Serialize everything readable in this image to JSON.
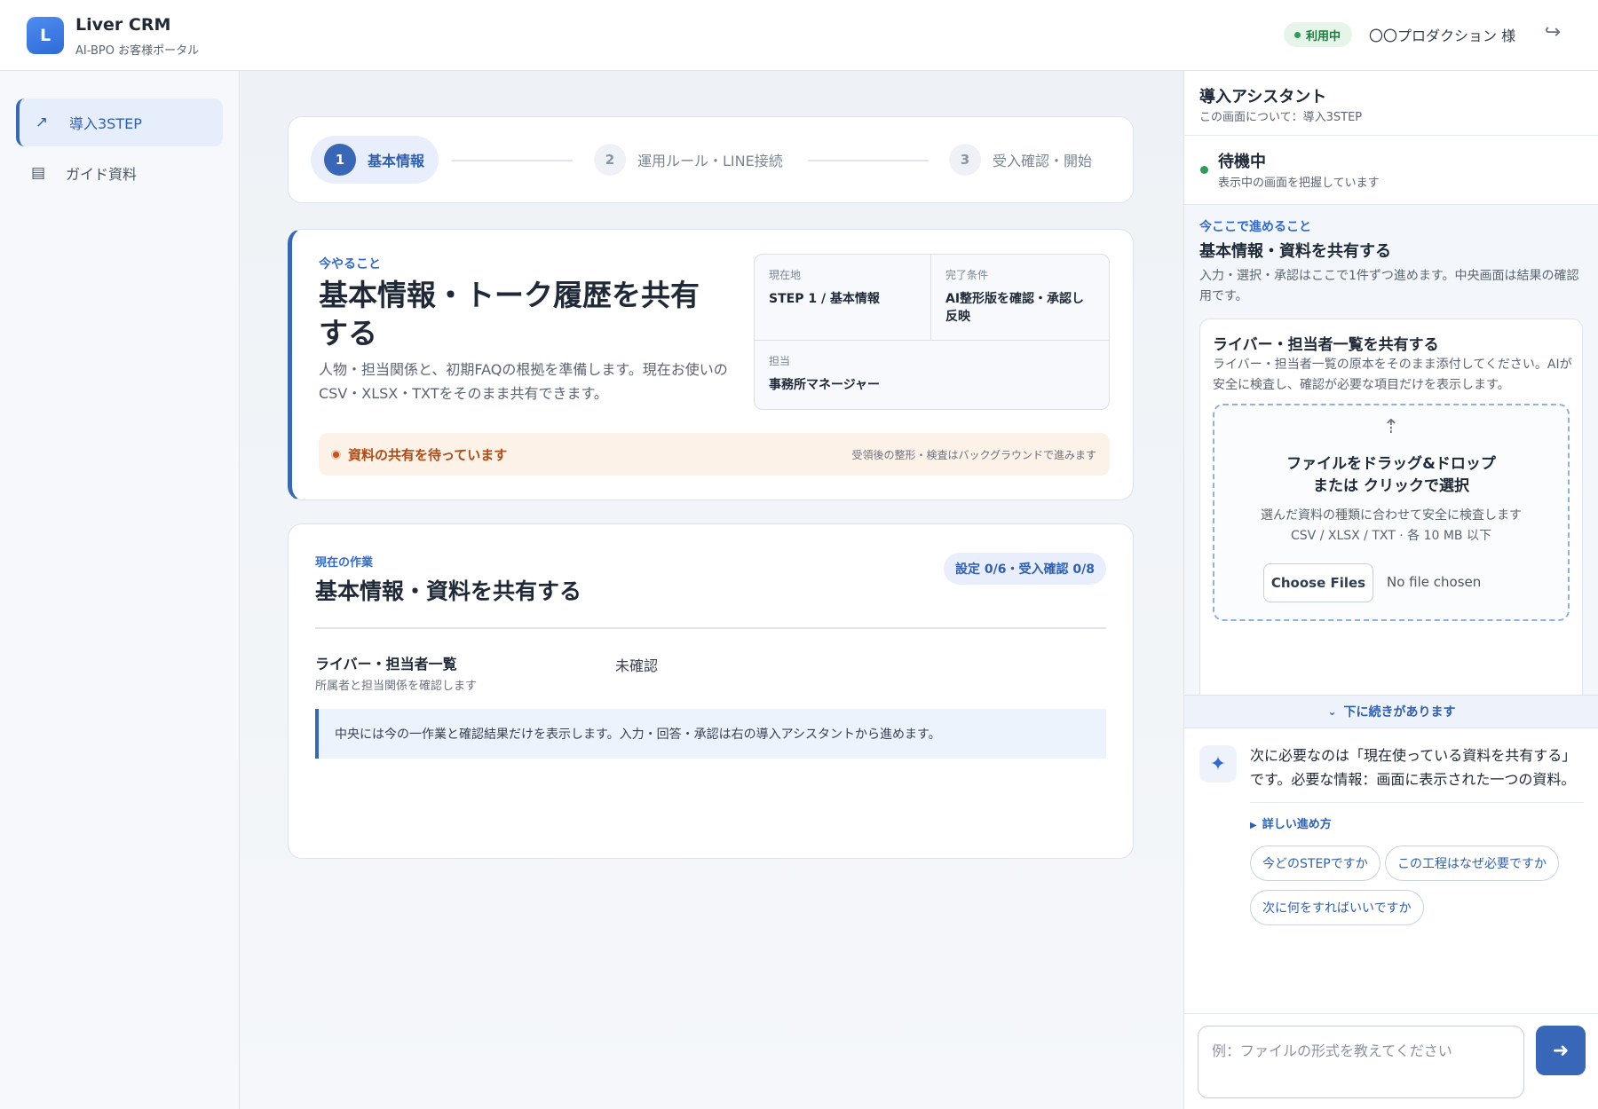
{
  "header": {
    "logo_letter": "L",
    "app_title": "Liver CRM",
    "app_subtitle": "AI-BPO お客様ポータル",
    "status": "利用中",
    "status_color": "#2e9c57",
    "user": "〇〇プロダクション 様",
    "logout_icon": "logout-icon"
  },
  "sidebar": {
    "items": [
      {
        "label": "導入3STEP",
        "icon": "trend-arrow-icon",
        "active": true
      },
      {
        "label": "ガイド資料",
        "icon": "document-icon",
        "active": false
      }
    ]
  },
  "stepper": {
    "steps": [
      {
        "num": "1",
        "label": "基本情報",
        "active": true
      },
      {
        "num": "2",
        "label": "運用ルール・LINE接続",
        "active": false
      },
      {
        "num": "3",
        "label": "受入確認・開始",
        "active": false
      }
    ]
  },
  "now_card": {
    "label": "今やること",
    "title": "基本情報・トーク履歴を共有する",
    "description": "人物・担当関係と、初期FAQの根拠を準備します。現在お使いのCSV・XLSX・TXTをそのまま共有できます。",
    "info": {
      "location_key": "現在地",
      "location_value": "STEP 1 / 基本情報",
      "completion_key": "完了条件",
      "completion_value": "AI整形版を確認・承認し反映",
      "owner_key": "担当",
      "owner_value": "事務所マネージャー"
    },
    "alert": {
      "message": "資料の共有を待っています",
      "note": "受領後の整形・検査はバックグラウンドで進みます"
    }
  },
  "work_card": {
    "label": "現在の作業",
    "title": "基本情報・資料を共有する",
    "progress": "設定 0/6・受入確認 0/8",
    "item": {
      "name": "ライバー・担当者一覧",
      "sub": "所属者と担当関係を確認します",
      "status": "未確認"
    },
    "note": "中央には今の一作業と確認結果だけを表示します。入力・回答・承認は右の導入アシスタントから進めます。"
  },
  "assistant": {
    "title": "導入アシスタント",
    "subtitle": "この画面について：導入3STEP",
    "idle_title": "待機中",
    "idle_sub": "表示中の画面を把握しています",
    "here_label": "今ここで進めること",
    "here_title": "基本情報・資料を共有する",
    "here_desc": "入力・選択・承認はここで1件ずつ進めます。中央画面は結果の確認用です。",
    "upload": {
      "title": "ライバー・担当者一覧を共有する",
      "desc": "ライバー・担当者一覧の原本をそのまま添付してください。AIが安全に検査し、確認が必要な項目だけを表示します。",
      "drop_icon": "upload-arrow-icon",
      "drop_title_1": "ファイルをドラッグ&ドロップ",
      "drop_title_2": "または クリックで選択",
      "drop_desc_1": "選んだ資料の種類に合わせて安全に検査します",
      "drop_desc_2": "CSV / XLSX / TXT · 各 10 MB 以下",
      "choose_button": "Choose Files",
      "no_file": "No file chosen"
    },
    "more": "下に続きがあります",
    "message": "次に必要なのは「現在使っている資料を共有する」です。必要な情報：画面に表示された一つの資料。",
    "detail_link": "詳しい進め方",
    "chips": [
      "今どのSTEPですか",
      "この工程はなぜ必要ですか",
      "次に何をすればいいですか"
    ],
    "input_placeholder": "例：ファイルの形式を教えてください",
    "send_icon": "send-arrow-icon"
  },
  "colors": {
    "accent": "#3767b6",
    "alert_bg": "#fdf2e8",
    "alert_text": "#b24a12",
    "success": "#2e9c57"
  }
}
